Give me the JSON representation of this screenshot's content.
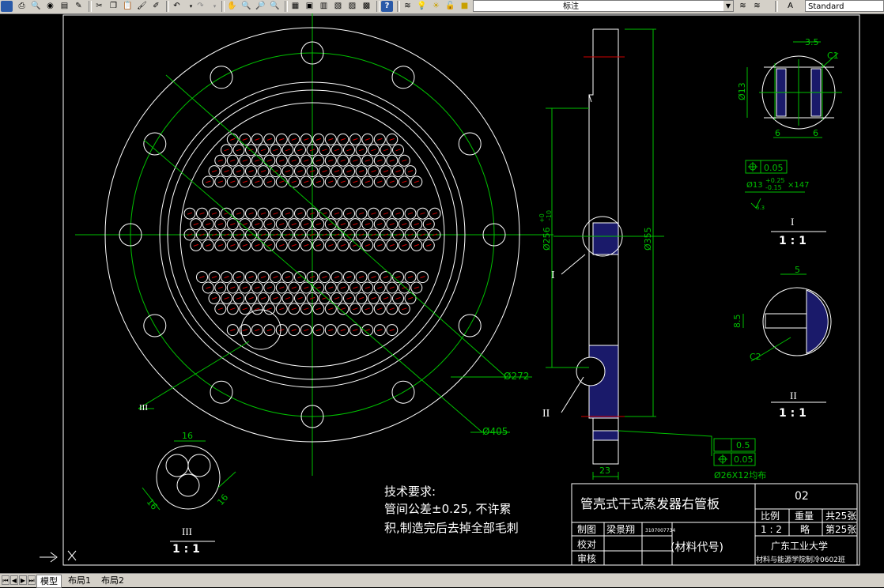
{
  "toolbar": {
    "layer_name": "标注",
    "text_style": "Standard"
  },
  "tabs": {
    "model": "模型",
    "layout1": "布局1",
    "layout2": "布局2"
  },
  "drawing": {
    "main_view": {
      "label_section_3": "III",
      "dim_inner": "Ø272",
      "dim_outer": "Ø405"
    },
    "side_view": {
      "label_detail_1": "I",
      "label_detail_2": "II",
      "dim_left": "Ø256",
      "dim_left_tol": "+0",
      "dim_left_tol2": "-10",
      "dim_right": "Ø355",
      "dim_width": "23",
      "tol_flat": "0.5",
      "tol_pos": "0.05",
      "holes_note": "Ø26X12均布"
    },
    "detail_1": {
      "dim_top": "3.5",
      "chamfer": "C1",
      "dim_dia": "Ø13",
      "dim_6a": "6",
      "dim_6b": "6",
      "pos_tol": "0.05",
      "hole_note_main": "Ø13",
      "hole_tol_up": "+0.25",
      "hole_tol_down": "-0.15",
      "hole_count": "×147",
      "rough": "6.3",
      "label": "I",
      "scale": "1 : 1"
    },
    "detail_2": {
      "dim_top": "5",
      "dim_left": "8.5",
      "chamfer": "C2",
      "label": "II",
      "scale": "1 : 1"
    },
    "detail_3": {
      "dim_top": "16",
      "dim_left": "16",
      "dim_right": "16",
      "label": "III",
      "scale": "1 : 1"
    },
    "tech_req": {
      "title": "技术要求:",
      "line1": "管间公差±0.25, 不许累",
      "line2": "积,制造完后去掉全部毛刺"
    },
    "title_block": {
      "part_name": "管壳式干式蒸发器右管板",
      "drawing_no": "02",
      "scale_label": "比例",
      "weight_label": "重量",
      "total_sheets": "共25张",
      "scale_value": "1 : 2",
      "weight_value": "略",
      "sheet_no": "第25张",
      "drawn_by_label": "制图",
      "drawn_by": "梁景翔",
      "student_id": "3107007734",
      "checked_label": "校对",
      "approved_label": "审核",
      "material": "(材料代号)",
      "school": "广东工业大学",
      "department": "材料与能源学院制冷0602班"
    }
  }
}
